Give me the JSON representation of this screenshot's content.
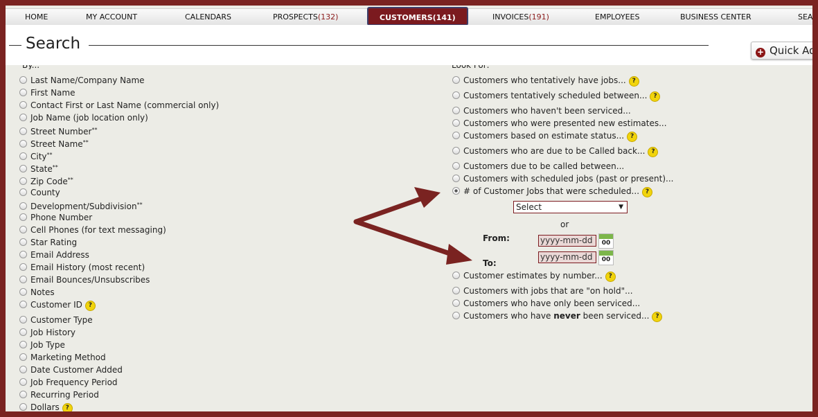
{
  "nav": {
    "home": "HOME",
    "my_account": "MY ACCOUNT",
    "calendars": "CALENDARS",
    "prospects": "PROSPECTS",
    "prospects_count": "(132)",
    "customers": "CUSTOMERS",
    "customers_count": "(141)",
    "invoices": "INVOICES",
    "invoices_count": "(191)",
    "employees": "EMPLOYEES",
    "business_center": "BUSINESS CENTER",
    "search": "SEAR"
  },
  "header": {
    "title": "Search",
    "quick_add": "Quick Add"
  },
  "by": {
    "items": [
      "Last Name/Company Name",
      "First Name",
      "Contact First or Last Name (commercial only)",
      "Job Name (job location only)",
      "Street Number",
      "Street Name",
      "City",
      "State",
      "Zip Code",
      "County",
      "Development/Subdivision",
      "Phone Number",
      "Cell Phones (for text messaging)",
      "Star Rating",
      "Email Address",
      "Email History (most recent)",
      "Email Bounces/Unsubscribes",
      "Notes",
      "Customer ID",
      "Customer Type",
      "Job History",
      "Job Type",
      "Marketing Method",
      "Date Customer Added",
      "Job Frequency Period",
      "Recurring Period",
      "Dollars"
    ],
    "asterisks": "**"
  },
  "look_for": {
    "items": [
      "Customers who tentatively have jobs...",
      "Customers tentatively scheduled between...",
      "Customers who haven't been serviced...",
      "Customers who were presented new estimates...",
      "Customers based on estimate status...",
      "Customers who are due to be Called back...",
      "Customers due to be called between...",
      "Customers with scheduled jobs (past or present)...",
      "# of Customer Jobs that were scheduled...",
      "Customer estimates by number...",
      "Customers with jobs that are \"on hold\"...",
      "Customers who have only been serviced..."
    ],
    "never_prefix": "Customers who have ",
    "never_bold": "never",
    "never_suffix": " been serviced...",
    "select_value": "Select",
    "or": "or",
    "from_label": "From:",
    "to_label": "To:",
    "date_placeholder": "yyyy-mm-dd",
    "calendar_icon_text": "00"
  },
  "help_symbol": "?",
  "colors": {
    "brand": "#7b1a1f",
    "background": "#ecece6",
    "help": "#f1d40c"
  }
}
